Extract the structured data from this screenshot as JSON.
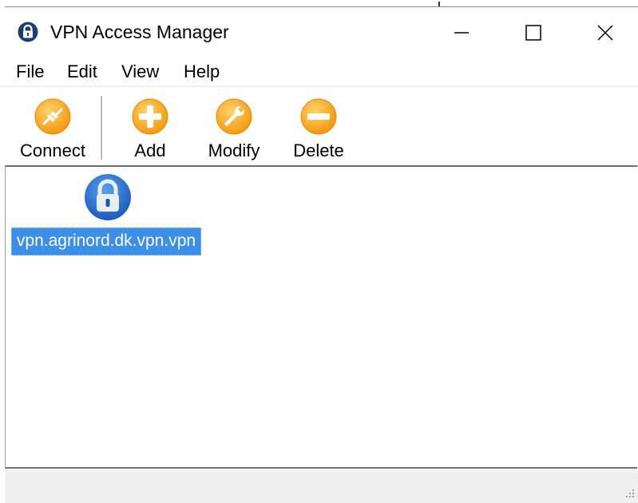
{
  "window": {
    "title": "VPN Access Manager",
    "app_icon": "lock-icon"
  },
  "titlebar_controls": {
    "minimize": "minimize-icon",
    "maximize": "maximize-icon",
    "close": "close-icon"
  },
  "menu": {
    "items": [
      "File",
      "Edit",
      "View",
      "Help"
    ]
  },
  "toolbar": {
    "buttons": [
      {
        "label": "Connect",
        "icon": "connect-plug-icon"
      },
      {
        "label": "Add",
        "icon": "plus-icon"
      },
      {
        "label": "Modify",
        "icon": "wrench-icon"
      },
      {
        "label": "Delete",
        "icon": "minus-icon"
      }
    ]
  },
  "connections": [
    {
      "label": "vpn.agrinord.dk.vpn.vpn",
      "icon": "lock-icon",
      "selected": true
    }
  ],
  "colors": {
    "toolbar_icon": "#f7a21b",
    "selection": "#3b8fe8",
    "lock_blue": "#1e64c8"
  }
}
